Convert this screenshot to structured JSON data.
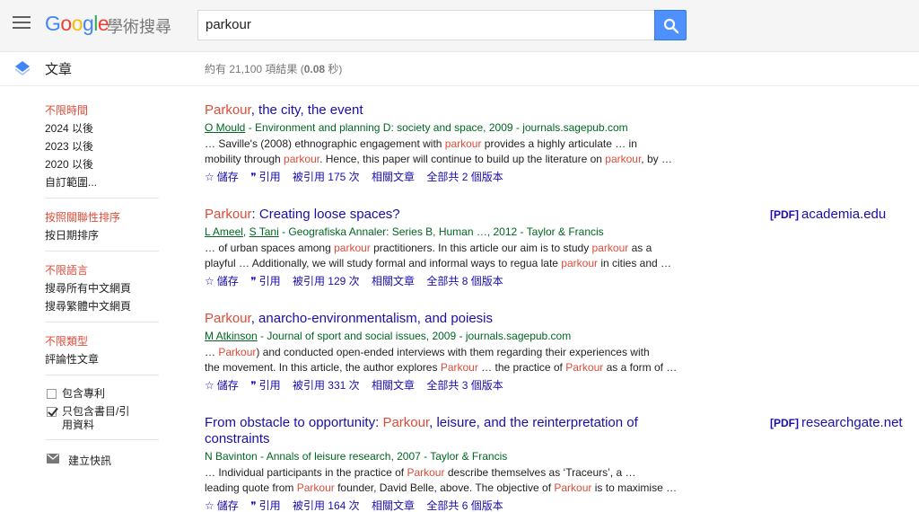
{
  "header": {
    "logo_text": "Google",
    "logo_sub": "學術搜尋",
    "search_value": "parkour"
  },
  "subheader": {
    "section_label": "文章",
    "stats_prefix": "約有 21,100 項結果 (",
    "stats_time": "0.08",
    "stats_suffix": " 秒)"
  },
  "sidebar": {
    "time": [
      "不限時間",
      "2024 以後",
      "2023 以後",
      "2020 以後",
      "自訂範圍..."
    ],
    "sort": [
      "按照關聯性排序",
      "按日期排序"
    ],
    "lang": [
      "不限語言",
      "搜尋所有中文網頁",
      "搜尋繁體中文網頁"
    ],
    "type": [
      "不限類型",
      "評論性文章"
    ],
    "include_patents": "包含專利",
    "include_citations": "只包含書目/引用資料",
    "create_alert": "建立快訊"
  },
  "links": {
    "save": "儲存",
    "cite": "引用",
    "related": "相關文章"
  },
  "results": [
    {
      "title_hl": "Parkour",
      "title_rest": ", the city, the event",
      "author": "O Mould",
      "meta": " - Environment and planning D: society and space, 2009 - journals.sagepub.com",
      "snip1a": "… Saville's (2008) ethnographic engagement with ",
      "snip1hl": "parkour",
      "snip1b": " provides a highly articulate … in",
      "snip2a": "mobility through ",
      "snip2hl": "parkour",
      "snip2b": ". Hence, this paper will continue to build up the literature on ",
      "snip2hl2": "parkour",
      "snip2c": ", by …",
      "cited": "被引用 175 次",
      "versions": "全部共 2 個版本"
    },
    {
      "title_hl": "Parkour",
      "title_rest": ": Creating loose spaces?",
      "author": "L Ameel",
      "author2": "S Tani",
      "meta": " - Geografiska Annaler: Series B, Human …, 2012 - Taylor & Francis",
      "snip1a": "… of urban spaces among ",
      "snip1hl": "parkour",
      "snip1b": " practitioners. In this article our aim is to study ",
      "snip1hl2": "parkour",
      "snip1c": " as a",
      "snip2a": "playful … Additionally, we will study formal and informal ways to regua late ",
      "snip2hl": "parkour",
      "snip2b": " in cities and …",
      "cited": "被引用 129 次",
      "versions": "全部共 8 個版本",
      "pdf_tag": "[PDF]",
      "pdf_site": "academia.edu"
    },
    {
      "title_hl": "Parkour",
      "title_rest": ", anarcho-environmentalism, and poiesis",
      "author": "M Atkinson",
      "meta": " - Journal of sport and social issues, 2009 - journals.sagepub.com",
      "snip1a": "… ",
      "snip1hl": "Parkour",
      "snip1b": ") and conducted open-ended interviews with them regarding their experiences with",
      "snip2a": "the movement. In this article, the author explores ",
      "snip2hl": "Parkour",
      "snip2b": " … the practice of ",
      "snip2hl2": "Parkour",
      "snip2c": " as a form of …",
      "cited": "被引用 331 次",
      "versions": "全部共 3 個版本"
    },
    {
      "title_a": "From obstacle to opportunity: ",
      "title_hl": "Parkour",
      "title_rest": ", leisure, and the reinterpretation of constraints",
      "author": "N Bavinton",
      "meta": " - Annals of leisure research, 2007 - Taylor & Francis",
      "snip1a": "… Individual participants in the practice of ",
      "snip1hl": "Parkour",
      "snip1b": " describe themselves as ‘Traceurs’, a …",
      "snip2a": "leading quote from ",
      "snip2hl": "Parkour",
      "snip2b": " founder, David Belle, above. The objective of ",
      "snip2hl2": "Parkour",
      "snip2c": " is to maximise …",
      "cited": "被引用 164 次",
      "versions": "全部共 6 個版本",
      "pdf_tag": "[PDF]",
      "pdf_site": "researchgate.net"
    }
  ],
  "colors": {
    "link": "#1a0dab",
    "highlight": "#dd4b39",
    "meta_green": "#006621",
    "search_blue": "#4d90fe"
  }
}
